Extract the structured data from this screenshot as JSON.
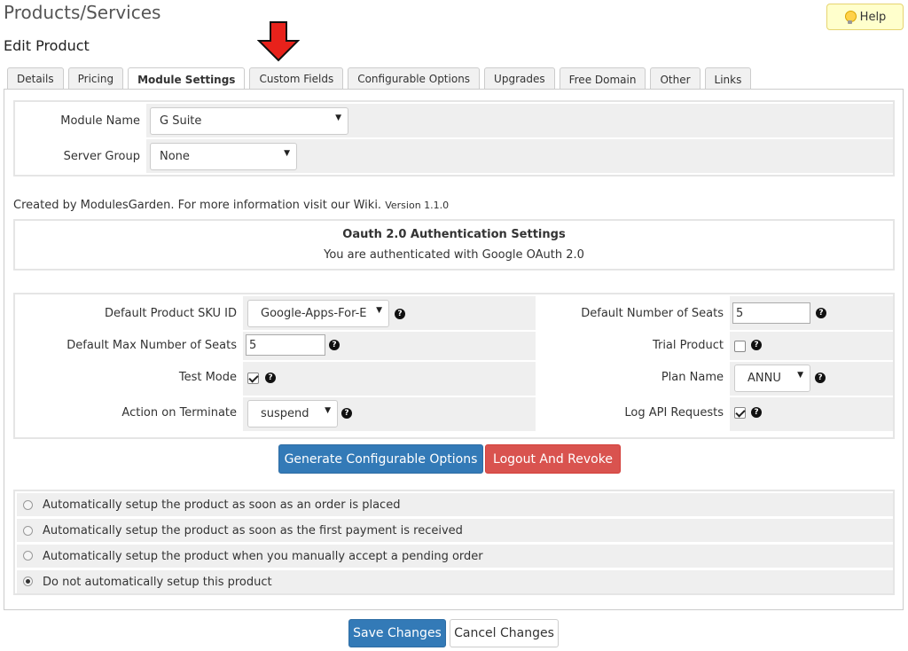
{
  "header": {
    "title": "Products/Services",
    "subtitle": "Edit Product",
    "help_label": "Help"
  },
  "tabs": [
    {
      "label": "Details"
    },
    {
      "label": "Pricing"
    },
    {
      "label": "Module Settings"
    },
    {
      "label": "Custom Fields"
    },
    {
      "label": "Configurable Options"
    },
    {
      "label": "Upgrades"
    },
    {
      "label": "Free Domain"
    },
    {
      "label": "Other"
    },
    {
      "label": "Links"
    }
  ],
  "module": {
    "module_name_label": "Module Name",
    "module_name_value": "G Suite",
    "server_group_label": "Server Group",
    "server_group_value": "None"
  },
  "credits": {
    "text": "Created by ModulesGarden. For more information visit our Wiki.",
    "version": "Version 1.1.0"
  },
  "oauth": {
    "title": "Oauth 2.0 Authentication Settings",
    "message": "You are authenticated with Google OAuth 2.0"
  },
  "settings": {
    "sku_label": "Default Product SKU ID",
    "sku_value": "Google-Apps-For-E",
    "max_seats_label": "Default Max Number of Seats",
    "max_seats_value": "5",
    "test_mode_label": "Test Mode",
    "terminate_label": "Action on Terminate",
    "terminate_value": "suspend",
    "num_seats_label": "Default Number of Seats",
    "num_seats_value": "5",
    "trial_label": "Trial Product",
    "plan_label": "Plan Name",
    "plan_value": "ANNU",
    "log_label": "Log API Requests"
  },
  "actions": {
    "generate_label": "Generate Configurable Options",
    "logout_label": "Logout And Revoke"
  },
  "setup_options": [
    {
      "label": "Automatically setup the product as soon as an order is placed"
    },
    {
      "label": "Automatically setup the product as soon as the first payment is received"
    },
    {
      "label": "Automatically setup the product when you manually accept a pending order"
    },
    {
      "label": "Do not automatically setup this product"
    }
  ],
  "footer": {
    "save_label": "Save Changes",
    "cancel_label": "Cancel Changes"
  },
  "colors": {
    "primary": "#337ab7",
    "danger": "#d9534f",
    "arrow": "#e8221b"
  }
}
